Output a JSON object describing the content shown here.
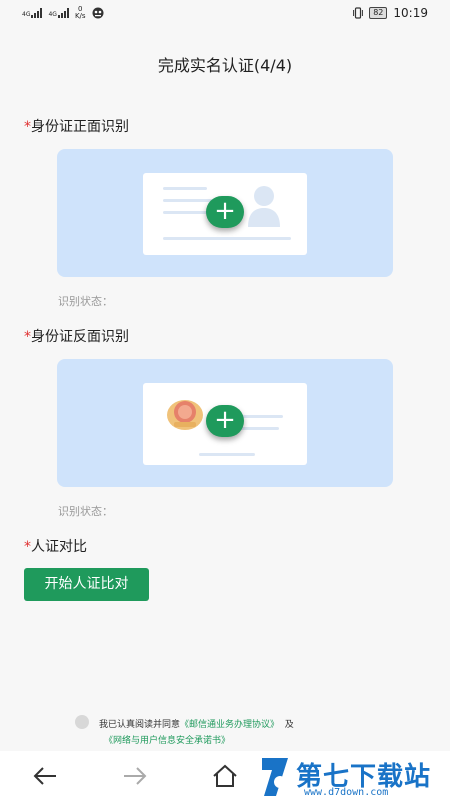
{
  "status_bar": {
    "signal1_label": "4G",
    "signal2_label": "4G",
    "net_speed_value": "0",
    "net_speed_unit": "K/s",
    "battery": "82",
    "time": "10:19"
  },
  "header": {
    "title": "完成实名认证(4/4)"
  },
  "sections": {
    "front": {
      "label": "身份证正面识别",
      "status_label": "识别状态："
    },
    "back": {
      "label": "身份证反面识别",
      "status_label": "识别状态："
    },
    "face": {
      "label": "人证对比",
      "button_label": "开始人证比对"
    },
    "required_mark": "*"
  },
  "agreement": {
    "text_prefix": "我已认真阅读并同意",
    "link1": "《邮信通业务办理协议》",
    "conj": "及",
    "link2": "《网络与用户信息安全承诺书》"
  },
  "nav": {
    "back_icon": "arrow-left-icon",
    "forward_icon": "arrow-right-icon",
    "home_icon": "home-icon"
  },
  "watermark": {
    "title": "第七下载站",
    "url": "www.d7down.com"
  },
  "colors": {
    "accent": "#1f9a5c",
    "card_bg": "#cfe3fb",
    "required": "#e03030",
    "watermark": "#1973c7"
  }
}
